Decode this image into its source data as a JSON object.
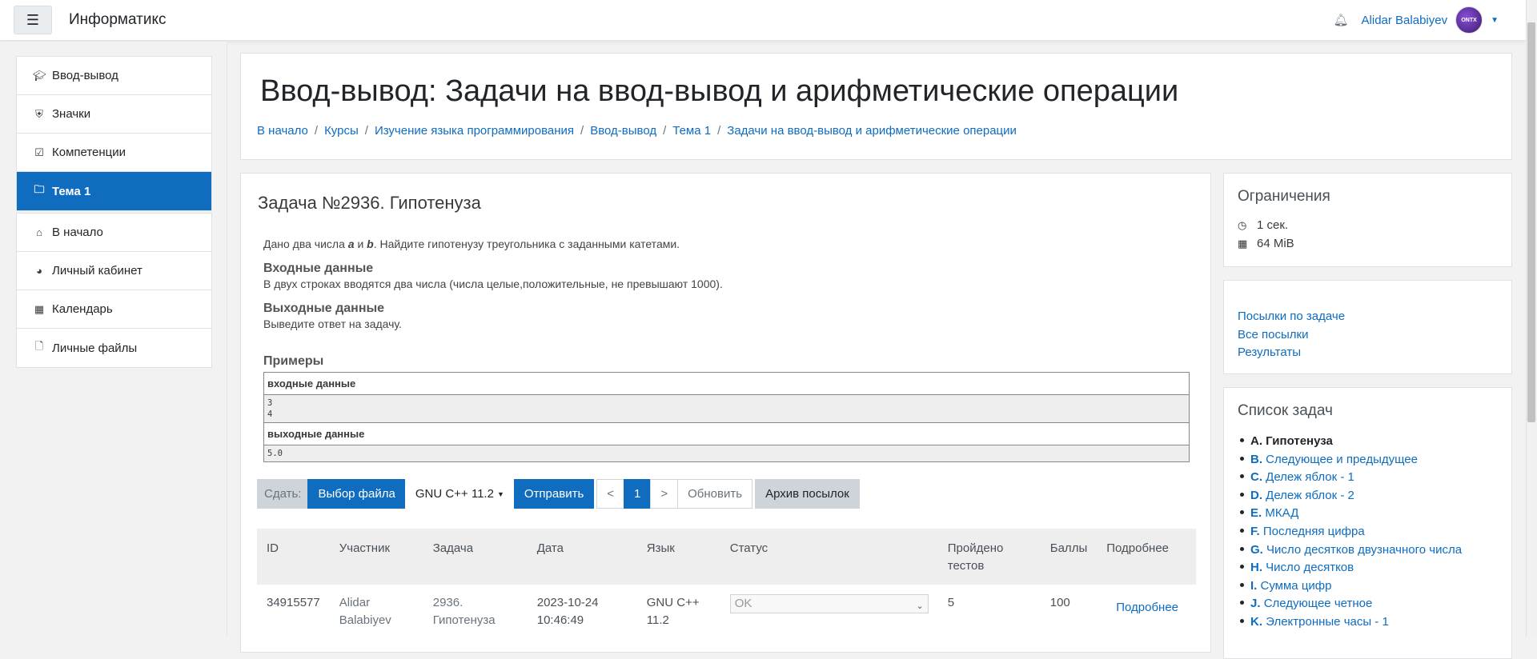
{
  "navbar": {
    "brand": "Информатикс",
    "user_name": "Alidar Balabiyev",
    "avatar_text": "ONTX"
  },
  "drawer": {
    "group1": [
      {
        "label": "Ввод-вывод",
        "icon": "graduation-cap-icon"
      },
      {
        "label": "Значки",
        "icon": "shield-icon"
      },
      {
        "label": "Компетенции",
        "icon": "check-square-icon"
      },
      {
        "label": "Тема 1",
        "icon": "folder-icon",
        "active": true
      }
    ],
    "group2": [
      {
        "label": "В начало",
        "icon": "home-icon"
      },
      {
        "label": "Личный кабинет",
        "icon": "dashboard-icon"
      },
      {
        "label": "Календарь",
        "icon": "calendar-icon"
      },
      {
        "label": "Личные файлы",
        "icon": "file-icon"
      }
    ]
  },
  "header": {
    "title": "Ввод-вывод: Задачи на ввод-вывод и арифметические операции",
    "breadcrumb": [
      "В начало",
      "Курсы",
      "Изучение языка программирования",
      "Ввод-вывод",
      "Тема 1",
      "Задачи на ввод-вывод и арифметические операции"
    ]
  },
  "problem": {
    "title": "Задача №2936. Гипотенуза",
    "statement_pre": "Дано два числа ",
    "var_a": "a",
    "and": " и ",
    "var_b": "b",
    "statement_post": ". Найдите гипотенузу треугольника с заданными катетами.",
    "input_head": "Входные данные",
    "input_text": "В двух строках вводятся два числа (числа целые,положительные, не превышают 1000).",
    "output_head": "Выходные данные",
    "output_text": "Выведите ответ на задачу.",
    "examples_head": "Примеры",
    "sample_input_label": "входные данные",
    "sample_input_line1": "3",
    "sample_input_line2": "4",
    "sample_output_label": "выходные данные",
    "sample_output_value": "5.0"
  },
  "toolbar": {
    "submit_label": "Сдать:",
    "choose_file": "Выбор файла",
    "language": "GNU C++ 11.2",
    "send": "Отправить",
    "prev": "<",
    "page": "1",
    "next": ">",
    "refresh": "Обновить",
    "archive": "Архив посылок"
  },
  "submissions": {
    "headers": {
      "id": "ID",
      "participant": "Участник",
      "task": "Задача",
      "date": "Дата",
      "lang": "Язык",
      "status": "Статус",
      "tests_line1": "Пройдено",
      "tests_line2": "тестов",
      "score": "Баллы",
      "details": "Подробнее"
    },
    "rows": [
      {
        "id": "34915577",
        "name_line1": "Alidar",
        "name_line2": "Balabiyev",
        "task_line1": "2936.",
        "task_line2": "Гипотенуза",
        "date_line1": "2023-10-24",
        "date_line2": "10:46:49",
        "lang_line1": "GNU C++",
        "lang_line2": "11.2",
        "status": "OK",
        "tests": "5",
        "score": "100",
        "details": "Подробнее"
      }
    ]
  },
  "limits": {
    "title": "Ограничения",
    "time": "1 сек.",
    "memory": "64 MiB"
  },
  "links": {
    "items": [
      "Посылки по задаче",
      "Все посылки",
      "Результаты"
    ]
  },
  "tasks": {
    "title": "Список задач",
    "items": [
      {
        "letter": "A.",
        "name": "Гипотенуза",
        "current": true
      },
      {
        "letter": "B.",
        "name": "Следующее и предыдущее"
      },
      {
        "letter": "C.",
        "name": "Дележ яблок - 1"
      },
      {
        "letter": "D.",
        "name": "Дележ яблок - 2"
      },
      {
        "letter": "E.",
        "name": "МКАД"
      },
      {
        "letter": "F.",
        "name": "Последняя цифра"
      },
      {
        "letter": "G.",
        "name": "Число десятков двузначного числа"
      },
      {
        "letter": "H.",
        "name": "Число десятков"
      },
      {
        "letter": "I.",
        "name": "Сумма цифр"
      },
      {
        "letter": "J.",
        "name": "Следующее четное"
      },
      {
        "letter": "K.",
        "name": "Электронные часы - 1"
      }
    ]
  }
}
